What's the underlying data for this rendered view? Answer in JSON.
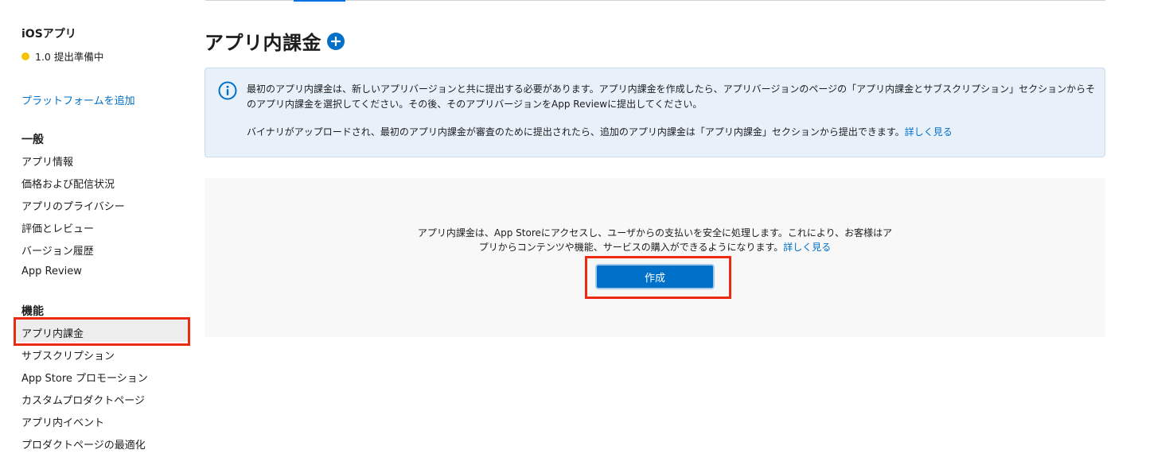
{
  "sidebar": {
    "app_name": "iOSアプリ",
    "status_text": "1.0 提出準備中",
    "status_color": "#f5c400",
    "add_platform": "プラットフォームを追加",
    "general_title": "一般",
    "general_items": [
      {
        "label": "アプリ情報"
      },
      {
        "label": "価格および配信状況"
      },
      {
        "label": "アプリのプライバシー"
      },
      {
        "label": "評価とレビュー"
      },
      {
        "label": "バージョン履歴"
      },
      {
        "label": "App Review"
      }
    ],
    "features_title": "機能",
    "feature_items": [
      {
        "label": "アプリ内課金",
        "selected": true
      },
      {
        "label": "サブスクリプション"
      },
      {
        "label": "App Store プロモーション"
      },
      {
        "label": "カスタムプロダクトページ"
      },
      {
        "label": "アプリ内イベント"
      },
      {
        "label": "プロダクトページの最適化"
      }
    ]
  },
  "main": {
    "title": "アプリ内課金",
    "add_icon": "plus-circle-icon",
    "info": {
      "icon": "info-circle-icon",
      "paragraph1": "最初のアプリ内課金は、新しいアプリバージョンと共に提出する必要があります。アプリ内課金を作成したら、アプリバージョンのページの「アプリ内課金とサブスクリプション」セクションからそのアプリ内課金を選択してください。その後、そのアプリバージョンをApp Reviewに提出してください。",
      "paragraph2": "バイナリがアップロードされ、最初のアプリ内課金が審査のために提出されたら、追加のアプリ内課金は「アプリ内課金」セクションから提出できます。",
      "learn_more": "詳しく見る"
    },
    "empty_state": {
      "text": "アプリ内課金は、App Storeにアクセスし、ユーザからの支払いを安全に処理します。これにより、お客様はアプリからコンテンツや機能、サービスの購入ができるようになります。",
      "learn_more": "詳しく見る",
      "create_button": "作成"
    }
  },
  "colors": {
    "accent": "#0070c9",
    "highlight": "#ee2a10",
    "info_bg": "#e8f1fa"
  }
}
